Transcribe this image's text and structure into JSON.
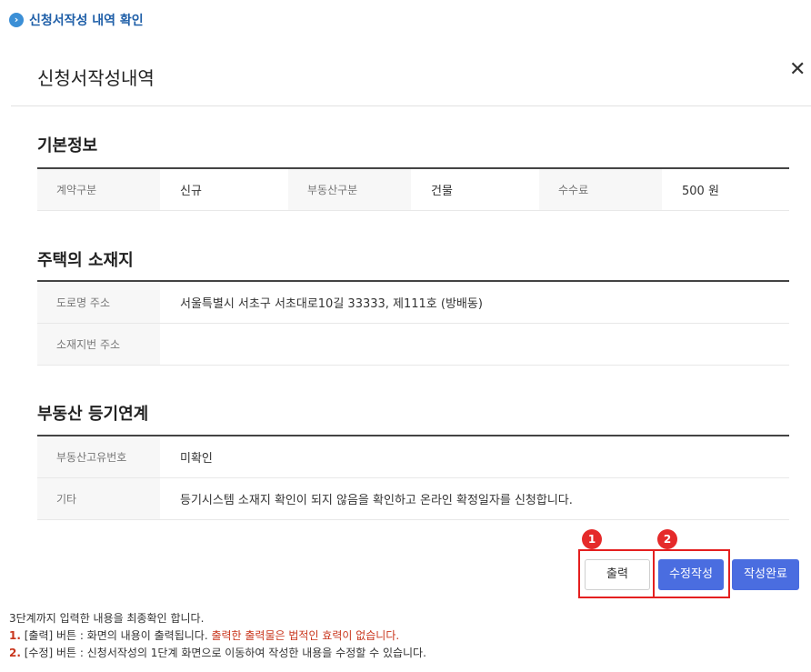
{
  "breadcrumb": {
    "icon": "chevron-right-icon",
    "text": "신청서작성 내역 확인"
  },
  "modal": {
    "title": "신청서작성내역",
    "close_icon": "close-icon"
  },
  "sections": {
    "basic": {
      "title": "기본정보",
      "contract_type_label": "계약구분",
      "contract_type_value": "신규",
      "property_type_label": "부동산구분",
      "property_type_value": "건물",
      "fee_label": "수수료",
      "fee_value": "500 원"
    },
    "location": {
      "title": "주택의 소재지",
      "road_label": "도로명 주소",
      "road_value": "서울특별시 서초구 서초대로10길 33333, 제111호 (방배동)",
      "lot_label": "소재지번 주소",
      "lot_value": ""
    },
    "registry": {
      "title": "부동산 등기연계",
      "unique_no_label": "부동산고유번호",
      "unique_no_value": "미확인",
      "etc_label": "기타",
      "etc_value": "등기시스템 소재지 확인이 되지 않음을 확인하고 온라인 확정일자를 신청합니다."
    }
  },
  "buttons": {
    "print": "출력",
    "edit": "수정작성",
    "complete": "작성완료"
  },
  "badges": {
    "first": "1",
    "second": "2"
  },
  "notes": {
    "line1": "3단계까지 입력한 내용을 최종확인 합니다.",
    "line2_num": "1.",
    "line2_text": " [출력] 버튼 : 화면의 내용이 출력됩니다. ",
    "line2_warn": "출력한 출력물은 법적인 효력이 없습니다.",
    "line3_num": "2.",
    "line3_text": " [수정] 버튼 : 신청서작성의 1단계 화면으로 이동하여 작성한 내용을 수정할 수 있습니다."
  },
  "colors": {
    "accent": "#4a6de0",
    "highlight": "#e41f1f",
    "warning": "#c9361d",
    "breadcrumb": "#1f5fa8"
  }
}
